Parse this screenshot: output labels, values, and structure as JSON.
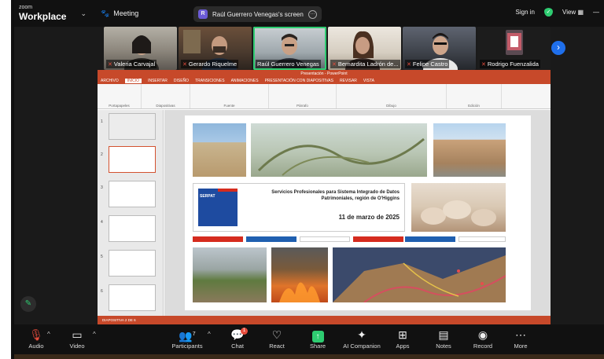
{
  "app": {
    "logo_top": "zoom",
    "logo_bottom": "Workplace",
    "meeting_label": "Meeting"
  },
  "screen_share": {
    "badge": "R",
    "label": "Raúl Guerrero Venegas's screen"
  },
  "top_right": {
    "signin": "Sign in",
    "view": "View"
  },
  "participants": [
    {
      "name": "Valeria Carvajal",
      "muted": true
    },
    {
      "name": "Gerardo Riquelme",
      "muted": true
    },
    {
      "name": "Raúl Guerrero Venegas",
      "muted": false,
      "active": true
    },
    {
      "name": "Bernardita Ladrón de...",
      "muted": true
    },
    {
      "name": "Felipe Castro",
      "muted": true
    },
    {
      "name": "Rodrigo Fuenzalida",
      "muted": true
    }
  ],
  "ppt": {
    "title": "Presentación - PowerPoint",
    "tabs": [
      "ARCHIVO",
      "INICIO",
      "INSERTAR",
      "DISEÑO",
      "TRANSICIONES",
      "ANIMACIONES",
      "PRESENTACIÓN CON DIAPOSITIVAS",
      "REVISAR",
      "VISTA"
    ],
    "groups": [
      "Portapapeles",
      "Diapositivas",
      "Fuente",
      "Párrafo",
      "Dibujo",
      "Edición"
    ],
    "slide_nums": [
      "1",
      "2",
      "3",
      "4",
      "5",
      "6"
    ],
    "slide_title": "Servicios Profesionales para Sistema Integrado de Datos Patrimoniales, región de O'Higgins",
    "slide_date": "11 de marzo de 2025",
    "gov_logo": "SERPAT",
    "status": "DIAPOSITIVA 2 DE 6"
  },
  "toolbar": {
    "audio": "Audio",
    "video": "Video",
    "participants": "Participants",
    "participants_count": "7",
    "chat": "Chat",
    "chat_badge": "1",
    "react": "React",
    "share": "Share",
    "ai": "AI Companion",
    "apps": "Apps",
    "notes": "Notes",
    "record": "Record",
    "more": "More"
  },
  "colors": {
    "accent": "#2ecc71",
    "ppt": "#c7492a",
    "blue": "#1f6feb"
  }
}
